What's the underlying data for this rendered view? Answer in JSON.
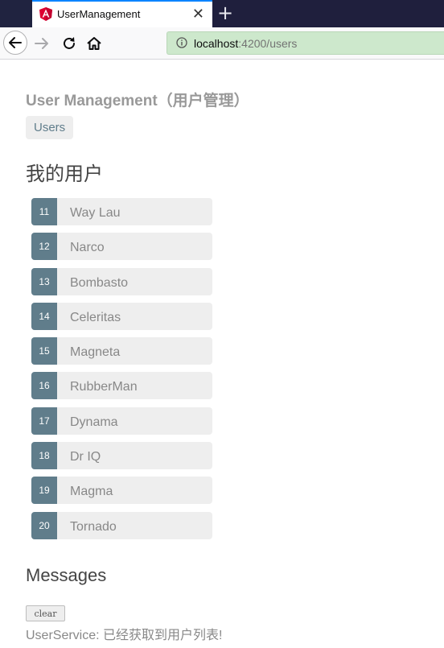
{
  "browser": {
    "tab_title": "UserManagement",
    "tab_icon": "angular-icon",
    "close_glyph": "✕",
    "new_tab_glyph": "+",
    "url_host": "localhost",
    "url_path": ":4200/users"
  },
  "app": {
    "title": "User Management（用户管理）",
    "nav_link": "Users",
    "section_heading": "我的用户"
  },
  "users": [
    {
      "id": "11",
      "name": "Way Lau"
    },
    {
      "id": "12",
      "name": "Narco"
    },
    {
      "id": "13",
      "name": "Bombasto"
    },
    {
      "id": "14",
      "name": "Celeritas"
    },
    {
      "id": "15",
      "name": "Magneta"
    },
    {
      "id": "16",
      "name": "RubberMan"
    },
    {
      "id": "17",
      "name": "Dynama"
    },
    {
      "id": "18",
      "name": "Dr IQ"
    },
    {
      "id": "19",
      "name": "Magma"
    },
    {
      "id": "20",
      "name": "Tornado"
    }
  ],
  "messages": {
    "heading": "Messages",
    "clear_label": "clear",
    "items": [
      "UserService: 已经获取到用户列表!"
    ]
  },
  "colors": {
    "badge": "#607d8b",
    "item_bg": "#eeeeee",
    "url_bar_bg": "#cde8cc",
    "tab_strip": "#1f1f3d"
  }
}
